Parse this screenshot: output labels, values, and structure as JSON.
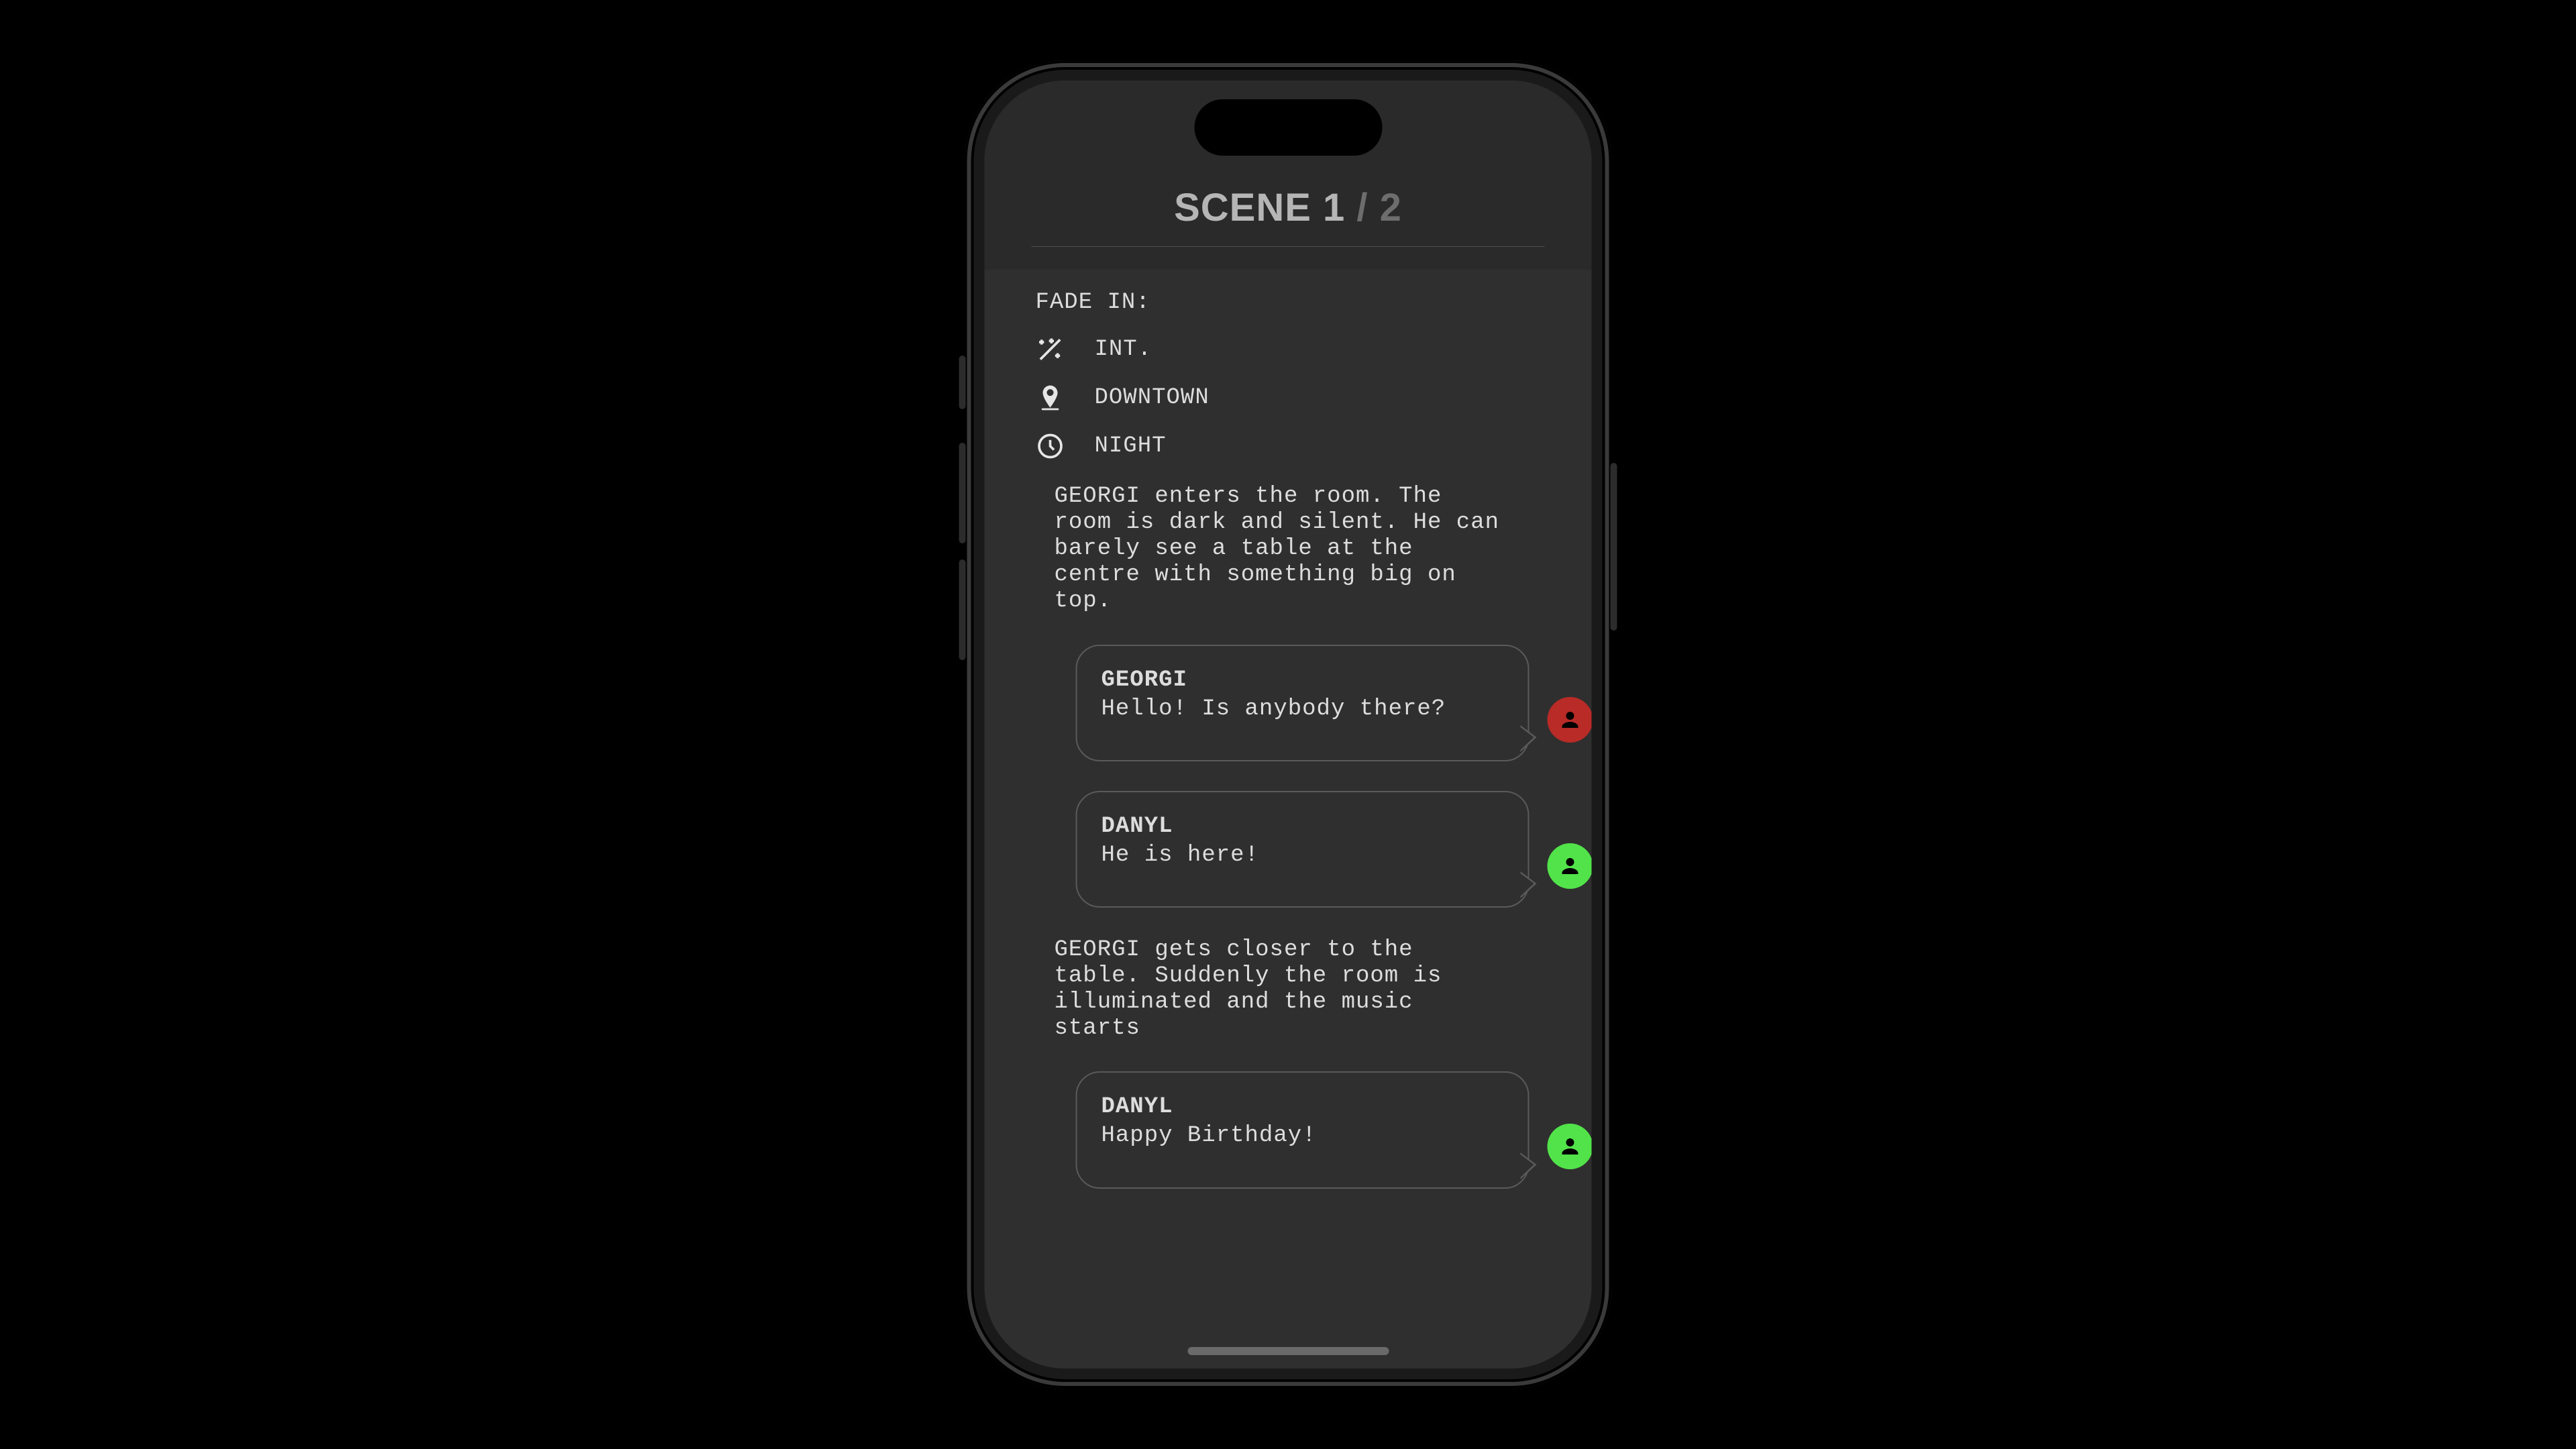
{
  "header": {
    "scene_word": "SCENE",
    "scene_number": "1",
    "scene_total": "2"
  },
  "transition_in": "FADE IN:",
  "slug": {
    "int_ext": "INT.",
    "location": "DOWNTOWN",
    "time": "NIGHT"
  },
  "blocks": [
    {
      "type": "action",
      "text": "GEORGI enters the room. The room is dark and silent. He can barely see a table at the centre with something big on top."
    },
    {
      "type": "dialogue",
      "character": "GEORGI",
      "line": "Hello! Is anybody there?",
      "badge_color": "#b82b27"
    },
    {
      "type": "dialogue",
      "character": "DANYL",
      "line": "He is here!",
      "badge_color": "#52e34a"
    },
    {
      "type": "action",
      "text": "GEORGI gets closer to the table. Suddenly the room is illuminated and the music starts"
    },
    {
      "type": "dialogue",
      "character": "DANYL",
      "line": "Happy Birthday!",
      "badge_color": "#52e34a"
    }
  ],
  "icons": {
    "int_ext": "wand-icon",
    "location": "pin-icon",
    "time": "clock-icon",
    "person": "person-icon"
  }
}
